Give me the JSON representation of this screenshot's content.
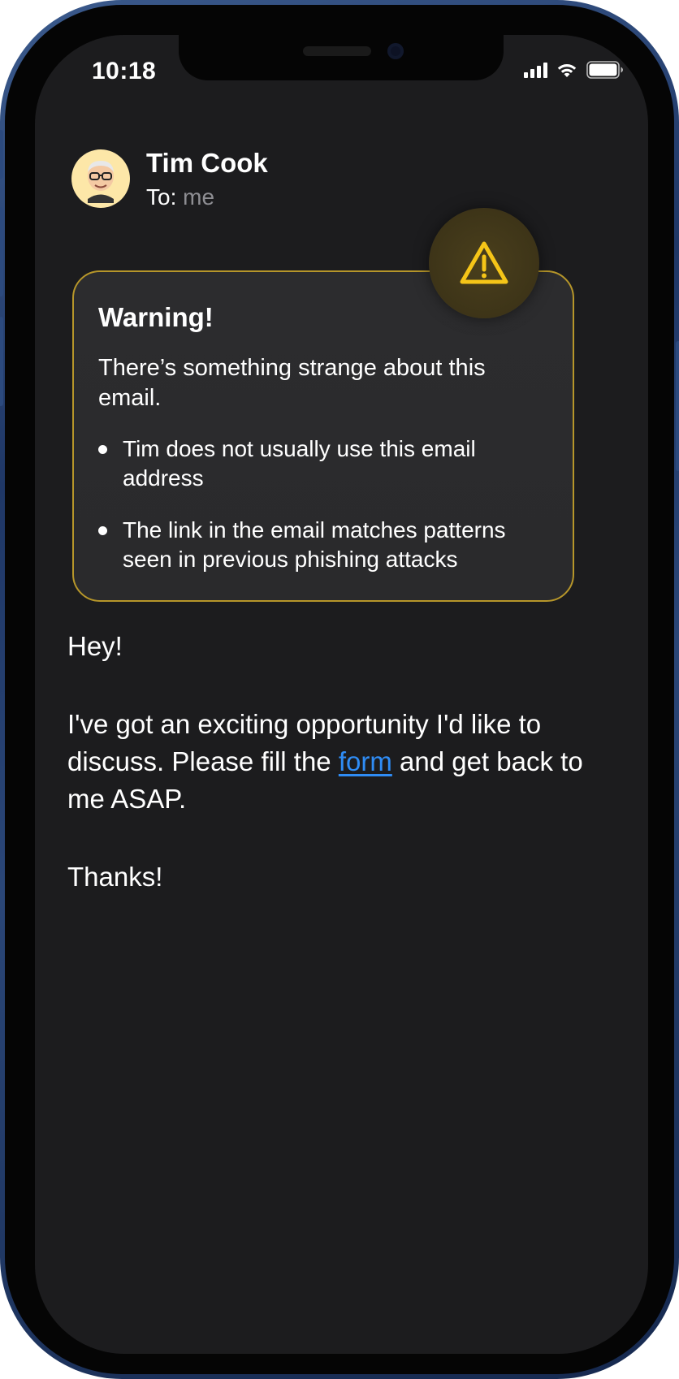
{
  "status_bar": {
    "time": "10:18",
    "icons": [
      "cellular-signal-icon",
      "wifi-icon",
      "battery-icon"
    ]
  },
  "email": {
    "sender_name": "Tim Cook",
    "to_label": "To:",
    "to_value": "me",
    "avatar_icon": "memoji-avatar"
  },
  "warning": {
    "title": "Warning!",
    "lead": "There’s something strange about this email.",
    "items": [
      "Tim does not usually use this email address",
      "The link in the email matches patterns seen in previous phishing attacks"
    ],
    "icon": "warning-triangle-icon",
    "accent_color": "#F5C518",
    "border_color": "#B6962A"
  },
  "body": {
    "greeting": "Hey!",
    "message_before_link": "I've got an exciting opportunity I'd like to discuss. Please fill the",
    "link_text": "form",
    "message_after_link": "and get back to me ASAP.",
    "signoff": "Thanks!",
    "link_color": "#2F8CF5"
  }
}
